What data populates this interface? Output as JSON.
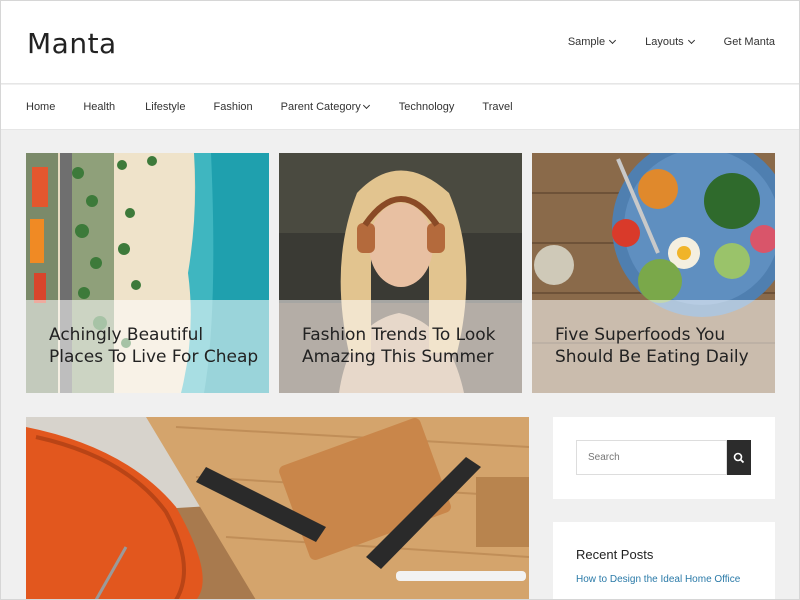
{
  "site": {
    "title": "Manta"
  },
  "top_nav": {
    "items": [
      {
        "label": "Sample",
        "has_dropdown": true
      },
      {
        "label": "Layouts",
        "has_dropdown": true
      },
      {
        "label": "Get Manta",
        "has_dropdown": false
      }
    ]
  },
  "main_nav": {
    "items": [
      {
        "label": "Home"
      },
      {
        "label": "Health"
      },
      {
        "label": "Lifestyle"
      },
      {
        "label": "Fashion"
      },
      {
        "label": "Parent Category",
        "has_dropdown": true
      },
      {
        "label": "Technology"
      },
      {
        "label": "Travel"
      }
    ]
  },
  "featured": [
    {
      "title_line1": "Achingly Beautiful",
      "title_line2": "Places To Live For Cheap"
    },
    {
      "title_line1": "Fashion Trends To Look",
      "title_line2": "Amazing This Summer"
    },
    {
      "title_line1": "Five Superfoods You",
      "title_line2": "Should Be Eating Daily"
    }
  ],
  "sidebar": {
    "search": {
      "placeholder": "Search"
    },
    "recent": {
      "heading": "Recent Posts",
      "posts": [
        {
          "title": "How to Design the Ideal Home Office"
        }
      ]
    }
  },
  "colors": {
    "accent_link": "#2a7aa8",
    "search_button": "#2c2c2c",
    "background": "#f0f0f0"
  }
}
